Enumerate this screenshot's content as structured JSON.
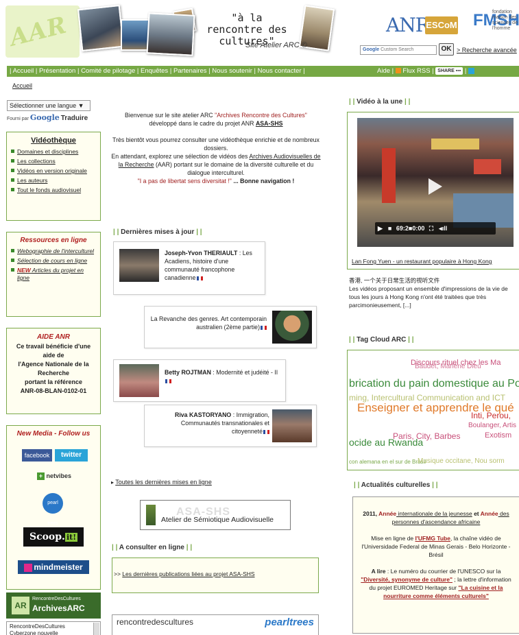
{
  "header": {
    "logo_text": "AAR",
    "tagline": "\"à la rencontre des cultures\"",
    "site_label": "Site Atelier ARC ©",
    "partner_anr": "ANR",
    "partner_escom": "ESCoM",
    "partner_fmsh": "FMSH",
    "partner_fmsh_sub": "fondation maison des sciences de l'homme",
    "search_placeholder": "Custom Search",
    "search_google": "Google",
    "search_button": "OK",
    "advanced_search": "> Recherche avancée"
  },
  "nav": {
    "items": [
      "Accueil",
      "Présentation",
      "Comité de pilotage",
      "Enquêtes",
      "Partenaires",
      "Nous soutenir",
      "Nous contacter"
    ],
    "help": "Aide",
    "rss": "Flux RSS",
    "share": "SHARE"
  },
  "breadcrumb": "Accueil",
  "language": {
    "select_label": "Sélectionner une langue ▼",
    "powered_by": "Fourni par",
    "google": "Google",
    "translate": "Traduire"
  },
  "videotheque": {
    "title": "Vidéothèque",
    "links": [
      "Domaines et disciplines",
      "Les collections",
      "Vidéos en version originale",
      "Les auteurs",
      "Tout le fonds audiovisuel"
    ]
  },
  "ressources": {
    "title": "Ressources en ligne",
    "links": [
      "Webographie de l'interculturel",
      "Sélection de cours en ligne"
    ],
    "new_prefix": "NEW",
    "new_link": "Articles du projet en ligne"
  },
  "aide": {
    "title": "AIDE ANR",
    "lines": [
      "Ce travail bénéficie d'une aide de",
      "l'Agence Nationale de la Recherche",
      "portant la référence",
      "ANR-08-BLAN-0102-01"
    ]
  },
  "media": {
    "title": "New Media - Follow us",
    "facebook": "facebook",
    "twitter": "twitter",
    "netvibes": "netvibes",
    "pearltrees": "pearl trees",
    "scoop": "Scoop.",
    "scoop_it": "it!",
    "mindmeister": "mindmeister"
  },
  "arc_widget": {
    "small": "RencontreDesCultures",
    "big": "ArchivesARC",
    "feed": "RencontreDesCultures Cyberzone nouvelle"
  },
  "intro": {
    "line1a": "Bienvenue sur le site atelier ARC ",
    "line1b": "\"Archives Rencontre des Cultures\"",
    "line2": "développé dans le cadre du projet ANR ",
    "line2_link": "ASA-SHS",
    "line3": "Très bientôt vous pourrez consulter une vidéothèque enrichie et de nombreux dossiers.",
    "line4a": "En attendant, explorez une sélection de vidéos des ",
    "line4_link": "Archives Audiovisuelles de la Recherche",
    "line4b": " (AAR) portant sur le domaine de la diversité culturelle et du dialogue interculturel.",
    "quote": "\"I a pas de libertat sens diversitat !\"",
    "closing": " ... Bonne navigation !"
  },
  "updates": {
    "section_title": "Dernières mises à jour",
    "items": [
      {
        "author": "Joseph-Yvon THERIAULT",
        "title": " : Les Acadiens, histoire d'une communauté francophone canadienne"
      },
      {
        "author": "",
        "title": "La Revanche des genres. Art contemporain australien (2ème partie)"
      },
      {
        "author": "Betty ROJTMAN",
        "title": " : Modernité et judéité - II"
      },
      {
        "author": "Riva KASTORYANO",
        "title": " : Immigration, Communautés transnationales et citoyenneté"
      }
    ],
    "all_link": "Toutes les dernières mises en ligne"
  },
  "asa_banner": {
    "ghost": "ASA-SHS",
    "label": "Atelier de Sémiotique Audiovisuelle"
  },
  "consult": {
    "section_title": "A consulter en ligne",
    "prefix": ">> ",
    "link": "Les dernières publications liées au projet ASA-SHS"
  },
  "pearltrees": {
    "name": "rencontredescultures",
    "brand": "pearltrees"
  },
  "video": {
    "section_title": "Vidéo à la une",
    "timecode": "69:2■0:00",
    "title": "Lan Fong Yuen - un restaurant populaire à Hong Kong",
    "chinese": "香港, 一个关于日常生活的视听文件",
    "description": "Les vidéos proposant un ensemble d'impressions de la vie de tous les jours à Hong Kong n'ont été traitées que très parcimonieusement, [...]"
  },
  "tags": {
    "section_title": "Tag Cloud ARC",
    "items": [
      {
        "text": "Discours rituel chez les Ma",
        "color": "#c8507a"
      },
      {
        "text": "Baudet, Marlène Dieu",
        "color": "#c8507a"
      },
      {
        "text": "brication du pain domestique au Port",
        "color": "#3a8a3a"
      },
      {
        "text": "ming, Intercultural Communication and ICT",
        "color": "#b8c070"
      },
      {
        "text": "Enseigner et apprendre le qué",
        "color": "#e07a2a"
      },
      {
        "text": "Inti, Perou,",
        "color": "#c82a2a"
      },
      {
        "text": "Boulanger, Artis",
        "color": "#c8507a"
      },
      {
        "text": "Paris, City, Barbes",
        "color": "#c8507a"
      },
      {
        "text": "ocide au Rwanda",
        "color": "#3a8a3a"
      },
      {
        "text": "Exotism",
        "color": "#c8507a"
      },
      {
        "text": "con alemana en el sur de Brasil",
        "color": "#7aa84a"
      },
      {
        "text": "Musique occitane, Nou sorm",
        "color": "#b8c070"
      }
    ]
  },
  "culture": {
    "section_title": "Actualités culturelles",
    "year": "2011, ",
    "annee1": "Année",
    "intl": " internationale de la jeunesse",
    "et": " et ",
    "annee2": "Année",
    "persons": " des personnes d'ascendance africaine",
    "p2a": "Mise en ligne de ",
    "p2_link": "l'UFMG Tube",
    "p2b": ", la chaîne vidéo de l'Universidade Federal de Minas Gerais - Belo Horizonte - Brésil",
    "p3_label": "A lire",
    "p3a": " : Le numéro du courrier de l'UNESCO sur la ",
    "p3_link1": "\"Diversité, synonyme de culture\"",
    "p3b": " ; la lettre d'information du projet EUROMED Heritage sur ",
    "p3_link2": "\"La cuisine et la nourriture comme éléments culturels\""
  }
}
